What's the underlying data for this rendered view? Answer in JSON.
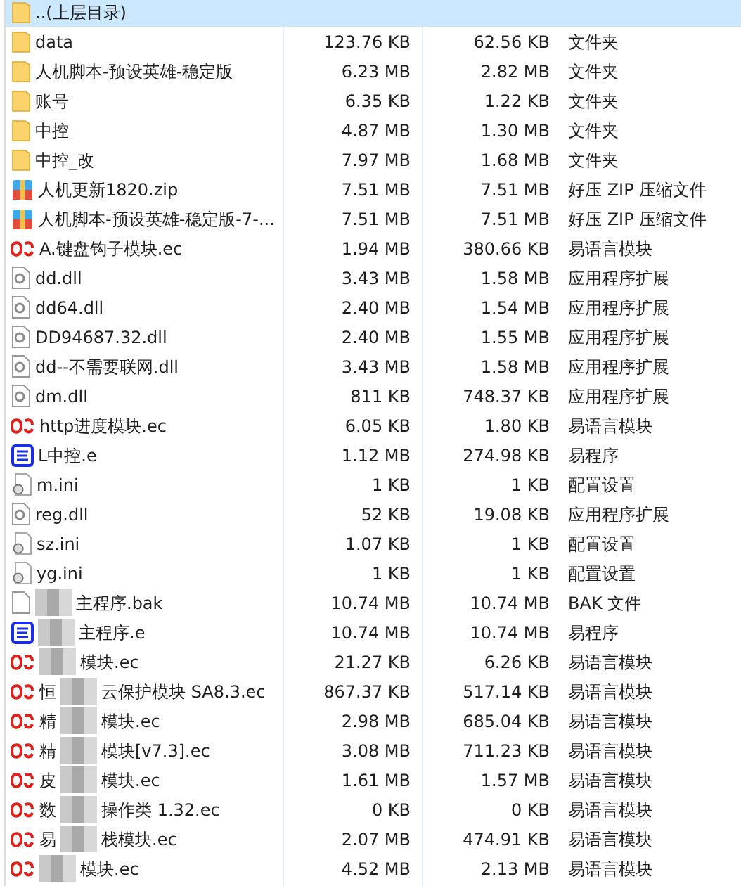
{
  "rows": [
    {
      "kind": "folder",
      "name": [
        "..(上层目录)"
      ],
      "size": "",
      "packed": "",
      "type": "",
      "selected": true
    },
    {
      "kind": "folder",
      "name": [
        "data"
      ],
      "size": "123.76 KB",
      "packed": "62.56 KB",
      "type": "文件夹",
      "selected": false
    },
    {
      "kind": "folder",
      "name": [
        "人机脚本-预设英雄-稳定版"
      ],
      "size": "6.23 MB",
      "packed": "2.82 MB",
      "type": "文件夹",
      "selected": false
    },
    {
      "kind": "folder",
      "name": [
        "账号"
      ],
      "size": "6.35 KB",
      "packed": "1.22 KB",
      "type": "文件夹",
      "selected": false
    },
    {
      "kind": "folder",
      "name": [
        "中控"
      ],
      "size": "4.87 MB",
      "packed": "1.30 MB",
      "type": "文件夹",
      "selected": false
    },
    {
      "kind": "folder",
      "name": [
        "中控_改"
      ],
      "size": "7.97 MB",
      "packed": "1.68 MB",
      "type": "文件夹",
      "selected": false
    },
    {
      "kind": "zip",
      "name": [
        "人机更新1820.zip"
      ],
      "size": "7.51 MB",
      "packed": "7.51 MB",
      "type": "好压 ZIP 压缩文件",
      "selected": false
    },
    {
      "kind": "zip",
      "name": [
        "人机脚本-预设英雄-稳定版-7-..."
      ],
      "size": "7.51 MB",
      "packed": "7.51 MB",
      "type": "好压 ZIP 压缩文件",
      "selected": false
    },
    {
      "kind": "ec",
      "name": [
        "A.键盘钩子模块.ec"
      ],
      "size": "1.94 MB",
      "packed": "380.66 KB",
      "type": "易语言模块",
      "selected": false
    },
    {
      "kind": "dll",
      "name": [
        "dd.dll"
      ],
      "size": "3.43 MB",
      "packed": "1.58 MB",
      "type": "应用程序扩展",
      "selected": false
    },
    {
      "kind": "dll",
      "name": [
        "dd64.dll"
      ],
      "size": "2.40 MB",
      "packed": "1.54 MB",
      "type": "应用程序扩展",
      "selected": false
    },
    {
      "kind": "dll",
      "name": [
        "DD94687.32.dll"
      ],
      "size": "2.40 MB",
      "packed": "1.55 MB",
      "type": "应用程序扩展",
      "selected": false
    },
    {
      "kind": "dll",
      "name": [
        "dd--不需要联网.dll"
      ],
      "size": "3.43 MB",
      "packed": "1.58 MB",
      "type": "应用程序扩展",
      "selected": false
    },
    {
      "kind": "dll",
      "name": [
        "dm.dll"
      ],
      "size": "811 KB",
      "packed": "748.37 KB",
      "type": "应用程序扩展",
      "selected": false
    },
    {
      "kind": "ec",
      "name": [
        "http进度模块.ec"
      ],
      "size": "6.05 KB",
      "packed": "1.80 KB",
      "type": "易语言模块",
      "selected": false
    },
    {
      "kind": "e",
      "name": [
        "L中控.e"
      ],
      "size": "1.12 MB",
      "packed": "274.98 KB",
      "type": "易程序",
      "selected": false
    },
    {
      "kind": "ini",
      "name": [
        "m.ini"
      ],
      "size": "1 KB",
      "packed": "1 KB",
      "type": "配置设置",
      "selected": false
    },
    {
      "kind": "dll",
      "name": [
        "reg.dll"
      ],
      "size": "52 KB",
      "packed": "19.08 KB",
      "type": "应用程序扩展",
      "selected": false
    },
    {
      "kind": "ini",
      "name": [
        "sz.ini"
      ],
      "size": "1.07 KB",
      "packed": "1 KB",
      "type": "配置设置",
      "selected": false
    },
    {
      "kind": "ini",
      "name": [
        "yg.ini"
      ],
      "size": "1 KB",
      "packed": "1 KB",
      "type": "配置设置",
      "selected": false
    },
    {
      "kind": "bak",
      "name": [
        "主程序.bak"
      ],
      "redacted": true,
      "size": "10.74 MB",
      "packed": "10.74 MB",
      "type": "BAK 文件",
      "selected": false
    },
    {
      "kind": "e",
      "name": [
        "主程序.e"
      ],
      "redacted": true,
      "size": "10.74 MB",
      "packed": "10.74 MB",
      "type": "易程序",
      "selected": false
    },
    {
      "kind": "ec",
      "name": [
        "模块.ec"
      ],
      "redacted": true,
      "size": "21.27 KB",
      "packed": "6.26 KB",
      "type": "易语言模块",
      "selected": false
    },
    {
      "kind": "ec",
      "name": [
        "恒",
        "云保护模块 SA8.3.ec"
      ],
      "redacted": true,
      "size": "867.37 KB",
      "packed": "517.14 KB",
      "type": "易语言模块",
      "selected": false
    },
    {
      "kind": "ec",
      "name": [
        "精",
        "模块.ec"
      ],
      "redacted": true,
      "size": "2.98 MB",
      "packed": "685.04 KB",
      "type": "易语言模块",
      "selected": false
    },
    {
      "kind": "ec",
      "name": [
        "精",
        "模块[v7.3].ec"
      ],
      "redacted": true,
      "size": "3.08 MB",
      "packed": "711.23 KB",
      "type": "易语言模块",
      "selected": false
    },
    {
      "kind": "ec",
      "name": [
        "皮",
        "模块.ec"
      ],
      "redacted": true,
      "size": "1.61 MB",
      "packed": "1.57 MB",
      "type": "易语言模块",
      "selected": false
    },
    {
      "kind": "ec",
      "name": [
        "数",
        "操作类 1.32.ec"
      ],
      "redacted": true,
      "size": "0 KB",
      "packed": "0 KB",
      "type": "易语言模块",
      "selected": false
    },
    {
      "kind": "ec",
      "name": [
        "易",
        "栈模块.ec"
      ],
      "redacted": true,
      "size": "2.07 MB",
      "packed": "474.91 KB",
      "type": "易语言模块",
      "selected": false
    },
    {
      "kind": "ec",
      "name": [
        "模块.ec"
      ],
      "redacted": true,
      "size": "4.52 MB",
      "packed": "2.13 MB",
      "type": "易语言模块",
      "selected": false
    }
  ]
}
